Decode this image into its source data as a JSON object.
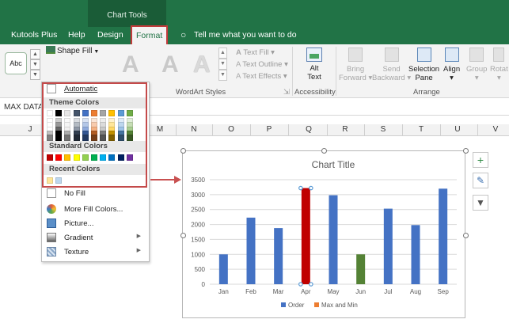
{
  "ribbon": {
    "context_group": "Chart Tools",
    "tabs": [
      "Kutools Plus",
      "Help",
      "Design",
      "Format"
    ],
    "active_tab": "Format",
    "tell_me": "Tell me what you want to do",
    "shape_fill": "Shape Fill",
    "abc": "Abc",
    "wordart": {
      "text_fill": "Text Fill",
      "text_outline": "Text Outline",
      "text_effects": "Text Effects",
      "group_label": "WordArt Styles",
      "letter": "A"
    },
    "accessibility": {
      "button_line1": "Alt",
      "button_line2": "Text",
      "group_label": "Accessibility"
    },
    "arrange": {
      "bring_forward": [
        "Bring",
        "Forward"
      ],
      "send_backward": [
        "Send",
        "Backward"
      ],
      "selection_pane": [
        "Selection",
        "Pane"
      ],
      "align": "Align",
      "group": "Group",
      "rotate": "Rotat",
      "group_label": "Arrange"
    }
  },
  "name_box": "MAX DATA",
  "columns": [
    "J",
    "M",
    "N",
    "O",
    "P",
    "Q",
    "R",
    "S",
    "T",
    "U",
    "V"
  ],
  "fill_menu": {
    "automatic": "Automatic",
    "theme_colors": "Theme Colors",
    "standard_colors": "Standard Colors",
    "recent_colors": "Recent Colors",
    "no_fill": "No Fill",
    "more_fill_colors": "More Fill Colors...",
    "picture": "Picture...",
    "gradient": "Gradient",
    "texture": "Texture",
    "theme_top": [
      "#ffffff",
      "#000000",
      "#e7e6e6",
      "#44546a",
      "#4472c4",
      "#ed7d31",
      "#a5a5a5",
      "#ffc000",
      "#5b9bd5",
      "#70ad47"
    ],
    "standard": [
      "#c00000",
      "#ff0000",
      "#ffc000",
      "#ffff00",
      "#92d050",
      "#00b050",
      "#00b0f0",
      "#0070c0",
      "#002060",
      "#7030a0"
    ],
    "recent": [
      "#ffe699",
      "#bdd7ee"
    ]
  },
  "chart_data": {
    "type": "bar",
    "title": "Chart Title",
    "categories": [
      "Jan",
      "Feb",
      "Mar",
      "Apr",
      "May",
      "Jun",
      "Jul",
      "Aug",
      "Sep"
    ],
    "series": [
      {
        "name": "Order",
        "values": [
          1000,
          2230,
          1880,
          3220,
          2980,
          1000,
          2530,
          1980,
          3200
        ]
      },
      {
        "name": "Max and Min",
        "values": [
          0,
          0,
          0,
          0,
          0,
          0,
          0,
          0,
          0
        ]
      }
    ],
    "ylim": [
      0,
      3500
    ],
    "yticks": [
      "0",
      "500",
      "1000",
      "1500",
      "2000",
      "2500",
      "3000",
      "3500"
    ],
    "gridlines": true,
    "legend_position": "bottom",
    "colors": {
      "order": "#4472c4",
      "max_and_min": "#ed7d31",
      "selected_max": "#c00000",
      "min_bar": "#548235"
    },
    "highlight_max_index": 3,
    "highlight_min_index": 5
  }
}
